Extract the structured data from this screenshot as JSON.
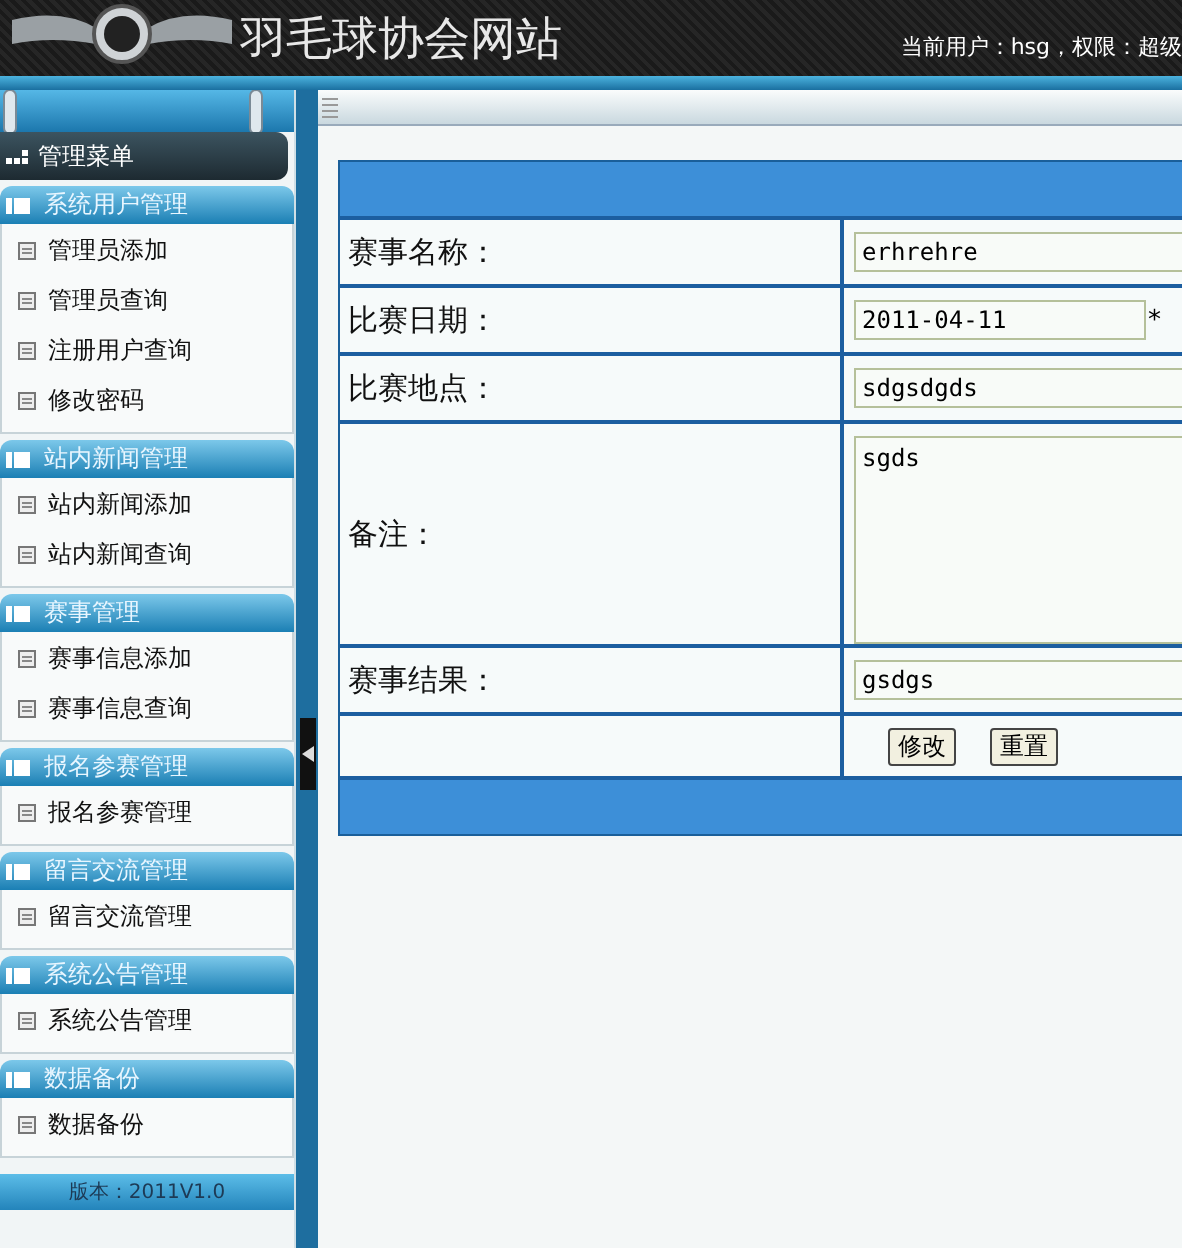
{
  "header": {
    "site_title": "羽毛球协会网站",
    "user_info": "当前用户：hsg，权限：超级"
  },
  "sidebar": {
    "title": "管理菜单",
    "groups": [
      {
        "label": "系统用户管理",
        "items": [
          "管理员添加",
          "管理员查询",
          "注册用户查询",
          "修改密码"
        ]
      },
      {
        "label": "站内新闻管理",
        "items": [
          "站内新闻添加",
          "站内新闻查询"
        ]
      },
      {
        "label": "赛事管理",
        "items": [
          "赛事信息添加",
          "赛事信息查询"
        ]
      },
      {
        "label": "报名参赛管理",
        "items": [
          "报名参赛管理"
        ]
      },
      {
        "label": "留言交流管理",
        "items": [
          "留言交流管理"
        ]
      },
      {
        "label": "系统公告管理",
        "items": [
          "系统公告管理"
        ]
      },
      {
        "label": "数据备份",
        "items": [
          "数据备份"
        ]
      }
    ],
    "version": "版本：2011V1.0"
  },
  "form": {
    "rows": [
      {
        "kind": "text",
        "label": "赛事名称：",
        "value": "erhrehre"
      },
      {
        "kind": "date",
        "label": "比赛日期：",
        "value": "2011-04-11",
        "required_mark": "*"
      },
      {
        "kind": "text",
        "label": "比赛地点：",
        "value": "sdgsdgds"
      },
      {
        "kind": "textarea",
        "label": "备注：",
        "value": "sgds"
      },
      {
        "kind": "text",
        "label": "赛事结果：",
        "value": "gsdgs"
      },
      {
        "kind": "buttons",
        "buttons": [
          "修改",
          "重置"
        ]
      }
    ]
  }
}
